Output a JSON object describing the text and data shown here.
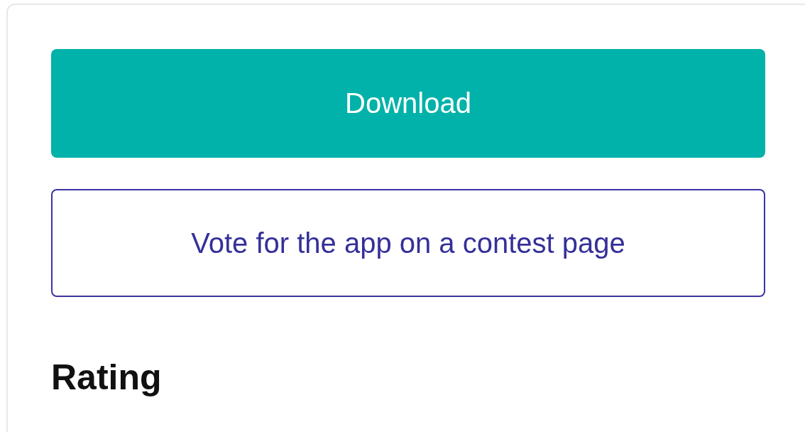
{
  "buttons": [
    {
      "label": "Download",
      "kind": "primary"
    },
    {
      "label": "Vote for the app on a contest page",
      "kind": "outline"
    }
  ],
  "section": {
    "heading": "Rating"
  }
}
